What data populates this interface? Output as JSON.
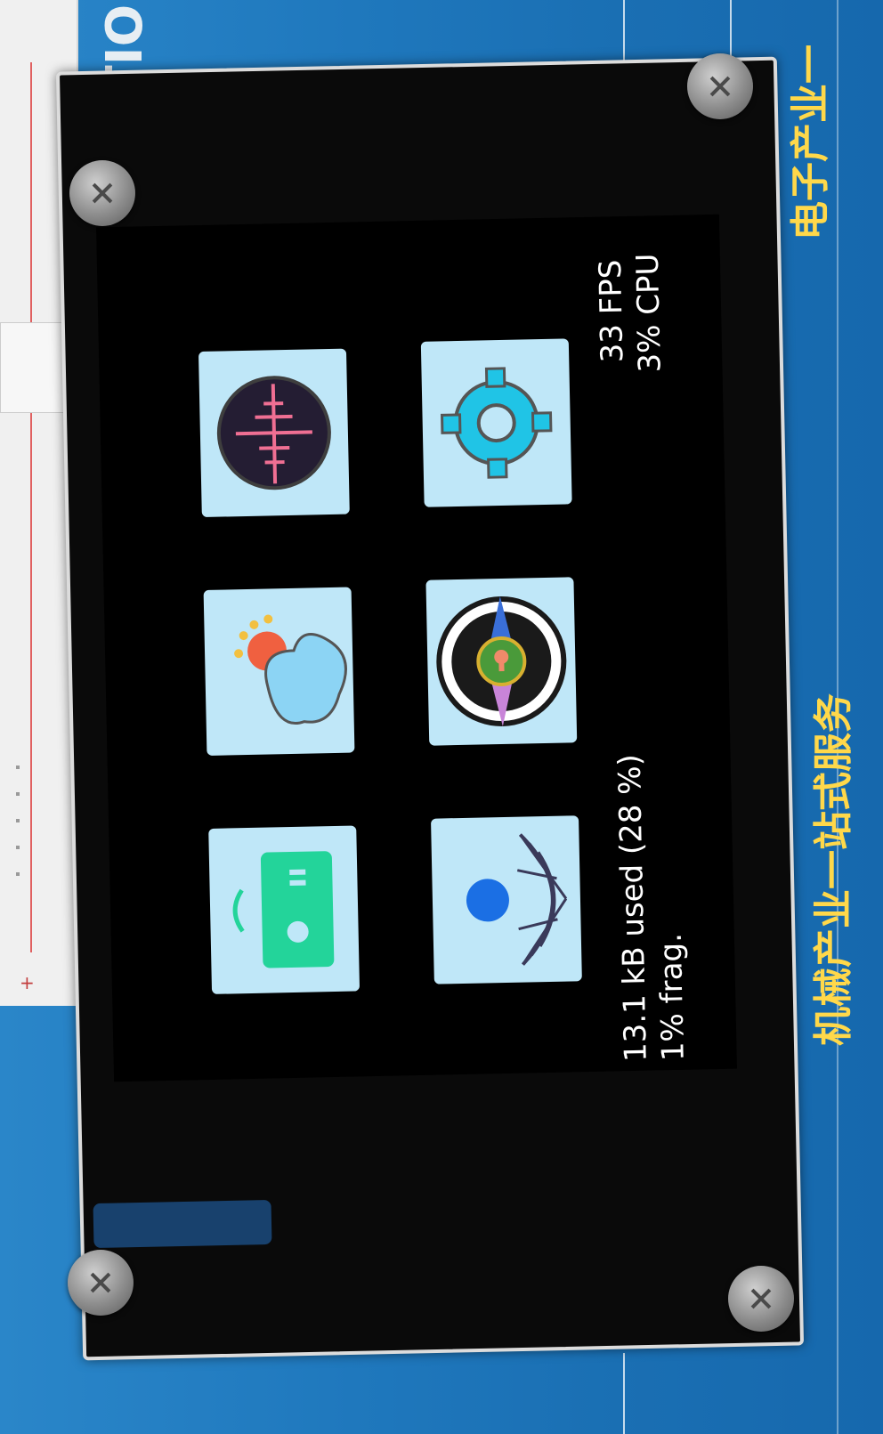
{
  "status": {
    "fps": "33 FPS",
    "cpu": "3% CPU",
    "memory_used": "13.1 kB used (28 %)",
    "fragmentation": "1% frag."
  },
  "apps": [
    {
      "icon": "sound-wave-icon"
    },
    {
      "icon": "gear-icon"
    },
    {
      "icon": "weather-icon"
    },
    {
      "icon": "compass-icon"
    },
    {
      "icon": "remote-control-icon"
    },
    {
      "icon": "satellite-dish-icon"
    }
  ],
  "pcb_text": {
    "vertical_left": "VATIO",
    "vertical_right_top": "电子产业一",
    "vertical_right_bottom": "机械产业一站式服务"
  },
  "colors": {
    "board_blue": "#1f78bd",
    "tile_bg": "#bfe7f8",
    "screen_bg": "#000000",
    "text": "#ffffff"
  }
}
